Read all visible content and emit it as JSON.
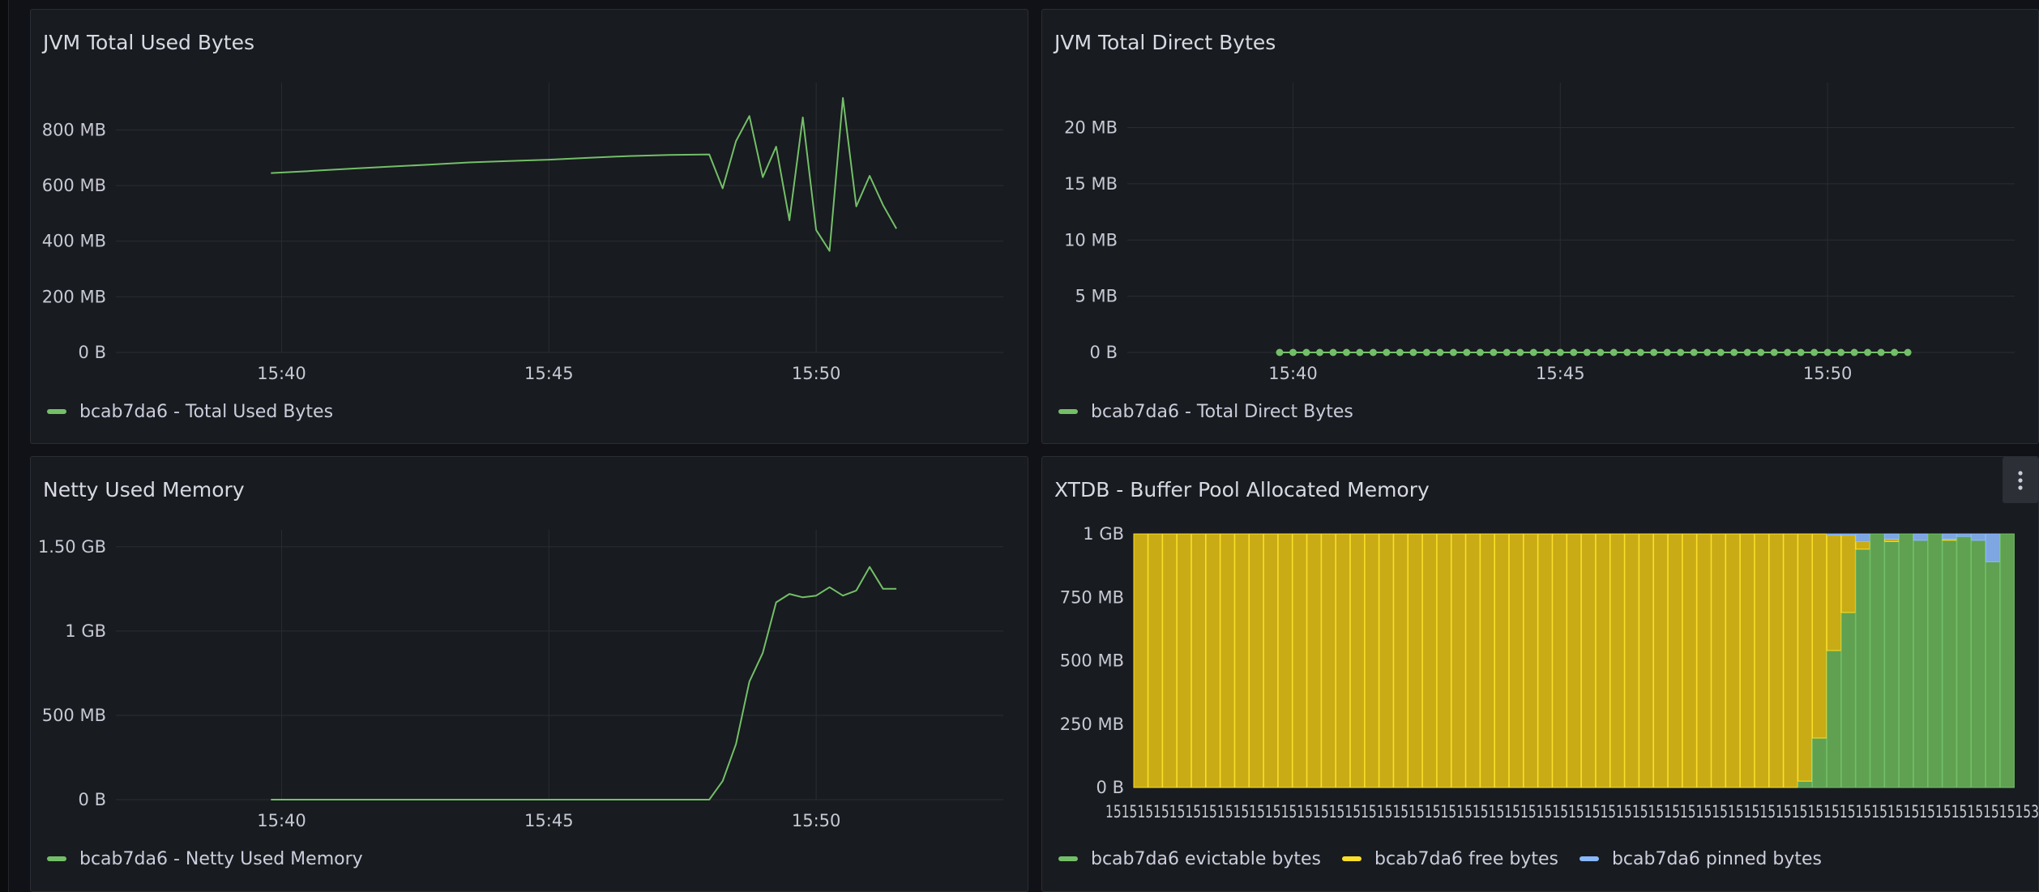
{
  "panels": [
    {
      "title": "JVM Total Used Bytes",
      "legend": [
        {
          "label": "bcab7da6 - Total Used Bytes",
          "color": "#73bf69"
        }
      ],
      "chart_data": {
        "type": "line",
        "title": "JVM Total Used Bytes",
        "x_ticks": [
          "15:40",
          "15:45",
          "15:50"
        ],
        "x_tick_minutes": [
          40,
          45,
          50
        ],
        "x_range_minutes": [
          36.9,
          53.5
        ],
        "y_ticks": [
          "0 B",
          "200 MB",
          "400 MB",
          "600 MB",
          "800 MB"
        ],
        "y_tick_values": [
          0,
          200,
          400,
          600,
          800
        ],
        "y_range": [
          0,
          970
        ],
        "markers": false,
        "series": [
          {
            "name": "bcab7da6 - Total Used Bytes",
            "color": "#73bf69",
            "x": [
              39.8,
              40.5,
              41.25,
              42.0,
              42.75,
              43.5,
              44.25,
              45.0,
              45.75,
              46.5,
              47.25,
              48.0,
              48.25,
              48.5,
              48.75,
              49.0,
              49.25,
              49.5,
              49.75,
              50.0,
              50.25,
              50.5,
              50.75,
              51.0,
              51.25,
              51.5
            ],
            "y": [
              645,
              652,
              660,
              668,
              675,
              683,
              688,
              693,
              700,
              706,
              710,
              712,
              590,
              760,
              850,
              630,
              740,
              475,
              845,
              440,
              365,
              915,
              525,
              635,
              530,
              445
            ]
          }
        ]
      }
    },
    {
      "title": "JVM Total Direct Bytes",
      "legend": [
        {
          "label": "bcab7da6 - Total Direct Bytes",
          "color": "#73bf69"
        }
      ],
      "chart_data": {
        "type": "line",
        "title": "JVM Total Direct Bytes",
        "x_ticks": [
          "15:40",
          "15:45",
          "15:50"
        ],
        "x_tick_minutes": [
          40,
          45,
          50
        ],
        "x_range_minutes": [
          36.9,
          53.5
        ],
        "y_ticks": [
          "0 B",
          "5 MB",
          "10 MB",
          "15 MB",
          "20 MB"
        ],
        "y_tick_values": [
          0,
          5,
          10,
          15,
          20
        ],
        "y_range": [
          0,
          24
        ],
        "markers": true,
        "series": [
          {
            "name": "bcab7da6 - Total Direct Bytes",
            "color": "#73bf69",
            "x": [
              39.75,
              40.0,
              40.25,
              40.5,
              40.75,
              41.0,
              41.25,
              41.5,
              41.75,
              42.0,
              42.25,
              42.5,
              42.75,
              43.0,
              43.25,
              43.5,
              43.75,
              44.0,
              44.25,
              44.5,
              44.75,
              45.0,
              45.25,
              45.5,
              45.75,
              46.0,
              46.25,
              46.5,
              46.75,
              47.0,
              47.25,
              47.5,
              47.75,
              48.0,
              48.25,
              48.5,
              48.75,
              49.0,
              49.25,
              49.5,
              49.75,
              50.0,
              50.25,
              50.5,
              50.75,
              51.0,
              51.25,
              51.5
            ],
            "y": [
              0,
              0,
              0,
              0,
              0,
              0,
              0,
              0,
              0,
              0,
              0,
              0,
              0,
              0,
              0,
              0,
              0,
              0,
              0,
              0,
              0,
              0,
              0,
              0,
              0,
              0,
              0,
              0,
              0,
              0,
              0,
              0,
              0,
              0,
              0,
              0,
              0,
              0,
              0,
              0,
              0,
              0,
              0,
              0,
              0,
              0,
              0,
              0
            ]
          }
        ]
      }
    },
    {
      "title": "Netty Used Memory",
      "legend": [
        {
          "label": "bcab7da6 - Netty Used Memory",
          "color": "#73bf69"
        }
      ],
      "chart_data": {
        "type": "line",
        "title": "Netty Used Memory",
        "x_ticks": [
          "15:40",
          "15:45",
          "15:50"
        ],
        "x_tick_minutes": [
          40,
          45,
          50
        ],
        "x_range_minutes": [
          36.9,
          53.5
        ],
        "y_ticks": [
          "0 B",
          "500 MB",
          "1 GB",
          "1.50 GB"
        ],
        "y_tick_values": [
          0,
          500,
          1000,
          1500
        ],
        "y_range": [
          0,
          1600
        ],
        "markers": false,
        "series": [
          {
            "name": "bcab7da6 - Netty Used Memory",
            "color": "#73bf69",
            "x": [
              39.8,
              42.0,
              44.0,
              46.0,
              48.0,
              48.25,
              48.5,
              48.75,
              49.0,
              49.25,
              49.5,
              49.75,
              50.0,
              50.25,
              50.5,
              50.75,
              51.0,
              51.25,
              51.5
            ],
            "y": [
              0,
              0,
              0,
              0,
              0,
              110,
              330,
              700,
              870,
              1170,
              1220,
              1200,
              1210,
              1260,
              1210,
              1240,
              1380,
              1250,
              1250
            ]
          }
        ]
      }
    },
    {
      "title": "XTDB - Buffer Pool Allocated Memory",
      "legend": [
        {
          "label": "bcab7da6 evictable bytes",
          "color": "#73bf69"
        },
        {
          "label": "bcab7da6 free bytes",
          "color": "#fade2a"
        },
        {
          "label": "bcab7da6 pinned bytes",
          "color": "#8ab8ff"
        }
      ],
      "chart_data": {
        "type": "bar",
        "stacked": true,
        "title": "XTDB - Buffer Pool Allocated Memory",
        "x_labels_overlapping": "151515151515151515151515151515151515151515151515151515151515151515151515151515151515151515151515151515151515151515153",
        "y_ticks": [
          "0 B",
          "250 MB",
          "500 MB",
          "750 MB",
          "1 GB"
        ],
        "y_tick_values": [
          0,
          250,
          500,
          750,
          1000
        ],
        "y_range": [
          0,
          1080
        ],
        "series": [
          {
            "name": "bcab7da6 evictable bytes",
            "color": "#73bf69",
            "fill": "#5fa150",
            "values": [
              0,
              0,
              0,
              0,
              0,
              0,
              0,
              0,
              0,
              0,
              0,
              0,
              0,
              0,
              0,
              0,
              0,
              0,
              0,
              0,
              0,
              0,
              0,
              0,
              0,
              0,
              0,
              0,
              0,
              0,
              0,
              0,
              0,
              0,
              0,
              0,
              0,
              0,
              0,
              0,
              0,
              0,
              0,
              0,
              0,
              0,
              25,
              195,
              540,
              690,
              940,
              1000,
              970,
              1000,
              975,
              1000,
              975,
              990,
              975,
              890,
              1000
            ]
          },
          {
            "name": "bcab7da6 free bytes",
            "color": "#fade2a",
            "fill": "#c9ab15",
            "values": [
              1000,
              1000,
              1000,
              1000,
              1000,
              1000,
              1000,
              1000,
              1000,
              1000,
              1000,
              1000,
              1000,
              1000,
              1000,
              1000,
              1000,
              1000,
              1000,
              1000,
              1000,
              1000,
              1000,
              1000,
              1000,
              1000,
              1000,
              1000,
              1000,
              1000,
              1000,
              1000,
              1000,
              1000,
              1000,
              1000,
              1000,
              1000,
              1000,
              1000,
              1000,
              1000,
              1000,
              1000,
              1000,
              1000,
              975,
              805,
              455,
              305,
              30,
              0,
              10,
              0,
              0,
              0,
              5,
              0,
              0,
              0,
              0
            ]
          },
          {
            "name": "bcab7da6 pinned bytes",
            "color": "#8ab8ff",
            "fill": "#7ea6e0",
            "values": [
              0,
              0,
              0,
              0,
              0,
              0,
              0,
              0,
              0,
              0,
              0,
              0,
              0,
              0,
              0,
              0,
              0,
              0,
              0,
              0,
              0,
              0,
              0,
              0,
              0,
              0,
              0,
              0,
              0,
              0,
              0,
              0,
              0,
              0,
              0,
              0,
              0,
              0,
              0,
              0,
              0,
              0,
              0,
              0,
              0,
              0,
              0,
              0,
              5,
              5,
              30,
              0,
              20,
              0,
              25,
              0,
              20,
              10,
              25,
              110,
              0
            ]
          }
        ]
      }
    }
  ],
  "menu_icon": "kebab-menu-icon"
}
